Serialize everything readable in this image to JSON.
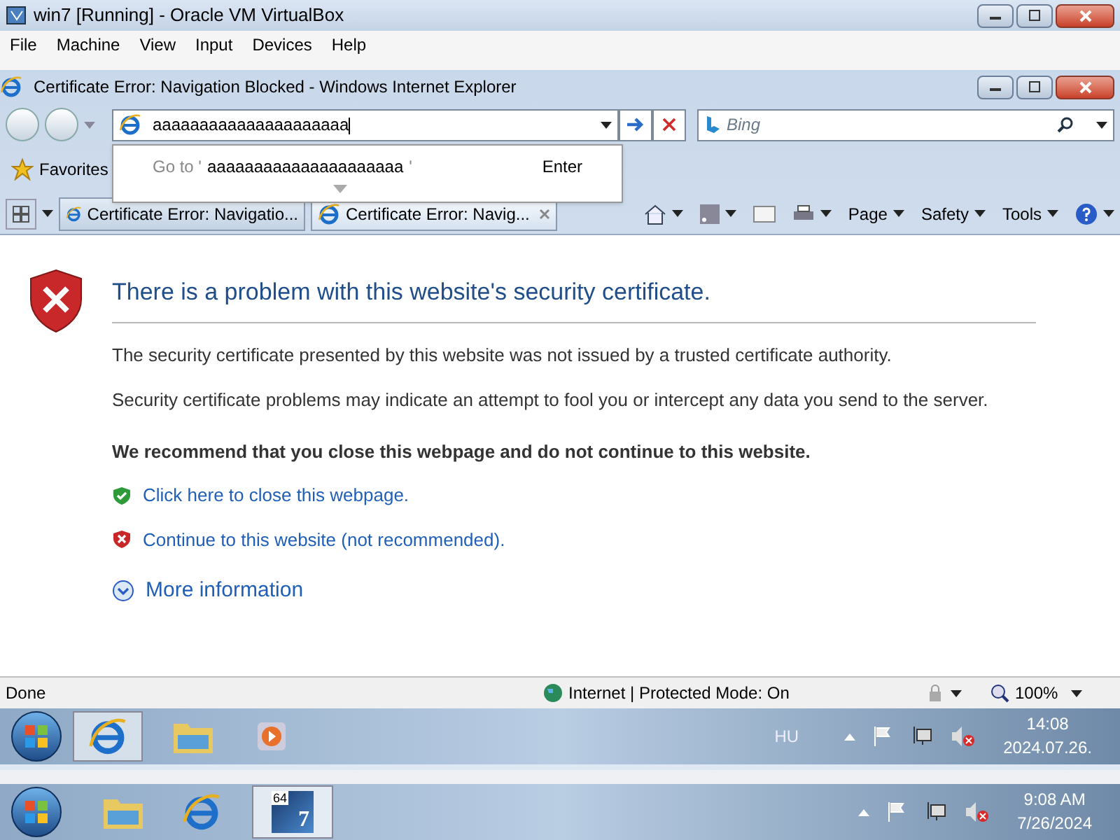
{
  "vbox": {
    "title": "win7 [Running] - Oracle VM VirtualBox",
    "menu": [
      "File",
      "Machine",
      "View",
      "Input",
      "Devices",
      "Help"
    ]
  },
  "ie": {
    "title": "Certificate Error: Navigation Blocked - Windows Internet Explorer",
    "address": {
      "value": "aaaaaaaaaaaaaaaaaaaaa"
    },
    "search": {
      "placeholder": "Bing"
    },
    "suggestion": {
      "prefix": "Go to '",
      "query": "aaaaaaaaaaaaaaaaaaaaa",
      "suffix": "'",
      "shortcut": "Enter"
    },
    "favorites": "Favorites",
    "tabs": [
      {
        "label": "Certificate Error: Navigatio...",
        "selected": false
      },
      {
        "label": "Certificate Error: Navig...",
        "selected": true
      }
    ],
    "commands": [
      "Page",
      "Safety",
      "Tools"
    ],
    "page": {
      "heading": "There is a problem with this website's security certificate.",
      "paragraphs": [
        "The security certificate presented by this website was not issued by a trusted certificate authority.",
        "Security certificate problems may indicate an attempt to fool you or intercept any data you send to the server."
      ],
      "recommendation": "We recommend that you close this webpage and do not continue to this website.",
      "links": [
        {
          "kind": "safe",
          "label": "Click here to close this webpage."
        },
        {
          "kind": "unsafe",
          "label": "Continue to this website (not recommended)."
        }
      ],
      "more": "More information"
    },
    "status": {
      "text": "Done",
      "zone": "Internet | Protected Mode: On",
      "zoom": "100%"
    }
  },
  "guest_taskbar": {
    "language": "HU",
    "time": "14:08",
    "date": "2024.07.26."
  },
  "host_taskbar": {
    "app_icon_texts": [
      "64",
      "7"
    ],
    "time": "9:08 AM",
    "date": "7/26/2024"
  }
}
